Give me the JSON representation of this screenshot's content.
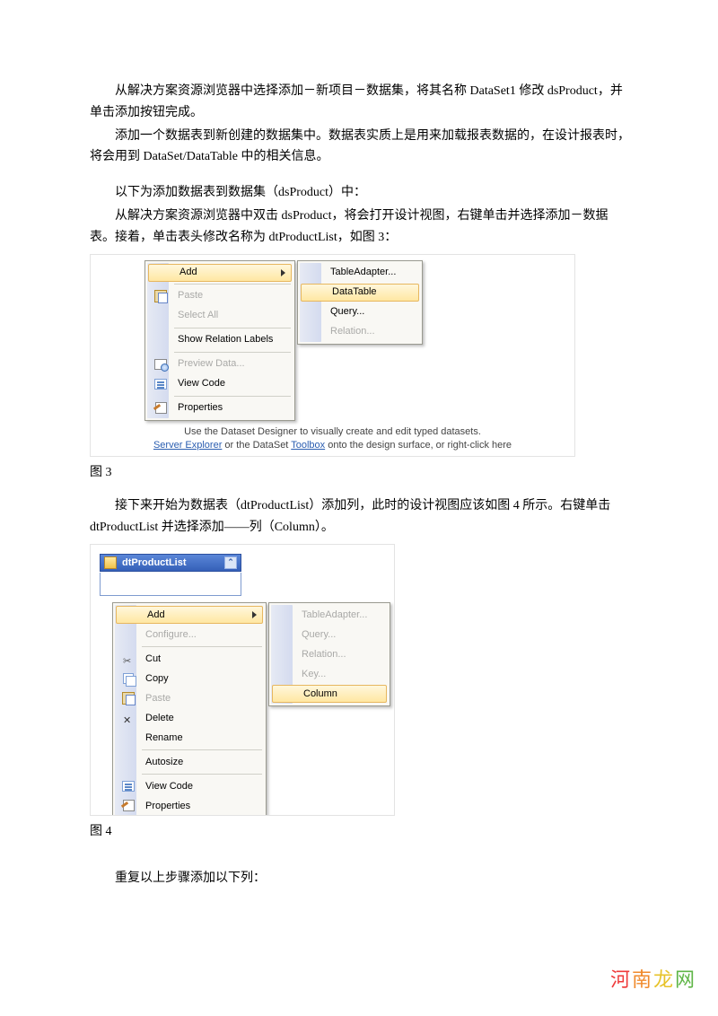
{
  "para1": "从解决方案资源浏览器中选择添加－新项目－数据集，将其名称 DataSet1 修改 dsProduct，并单击添加按钮完成。",
  "para2": "添加一个数据表到新创建的数据集中。数据表实质上是用来加载报表数据的，在设计报表时，将会用到 DataSet/DataTable 中的相关信息。",
  "para3": "以下为添加数据表到数据集（dsProduct）中：",
  "para4": "从解决方案资源浏览器中双击 dsProduct，将会打开设计视图，右键单击并选择添加－数据表。接着，单击表头修改名称为 dtProductList，如图 3：",
  "fig3_caption": "图 3",
  "para5": "接下来开始为数据表（dtProductList）添加列，此时的设计视图应该如图 4 所示。右键单击 dtProductList 并选择添加——列（Column）。",
  "fig4_caption": "图 4",
  "para6": "重复以上步骤添加以下列：",
  "fig3": {
    "menu1": {
      "add": "Add",
      "paste": "Paste",
      "select_all": "Select All",
      "show_relation": "Show Relation Labels",
      "preview": "Preview Data...",
      "view_code": "View Code",
      "properties": "Properties"
    },
    "menu2": {
      "tableadapter": "TableAdapter...",
      "datatable": "DataTable",
      "query": "Query...",
      "relation": "Relation..."
    },
    "hint_line1_pre": "Use the Dataset Designer to visually create and edit typed datasets.",
    "hint_line2_a": "Server Explorer",
    "hint_line2_mid": " or the DataSet ",
    "hint_line2_b": "Toolbox",
    "hint_line2_post": " onto the design surface, or right-click here"
  },
  "fig4": {
    "table_name": "dtProductList",
    "menu1": {
      "add": "Add",
      "configure": "Configure...",
      "cut": "Cut",
      "copy": "Copy",
      "paste": "Paste",
      "delete": "Delete",
      "rename": "Rename",
      "autosize": "Autosize",
      "view_code": "View Code",
      "properties": "Properties"
    },
    "menu2": {
      "tableadapter": "TableAdapter...",
      "query": "Query...",
      "relation": "Relation...",
      "key": "Key...",
      "column": "Column"
    }
  },
  "watermark": "河南龙网"
}
